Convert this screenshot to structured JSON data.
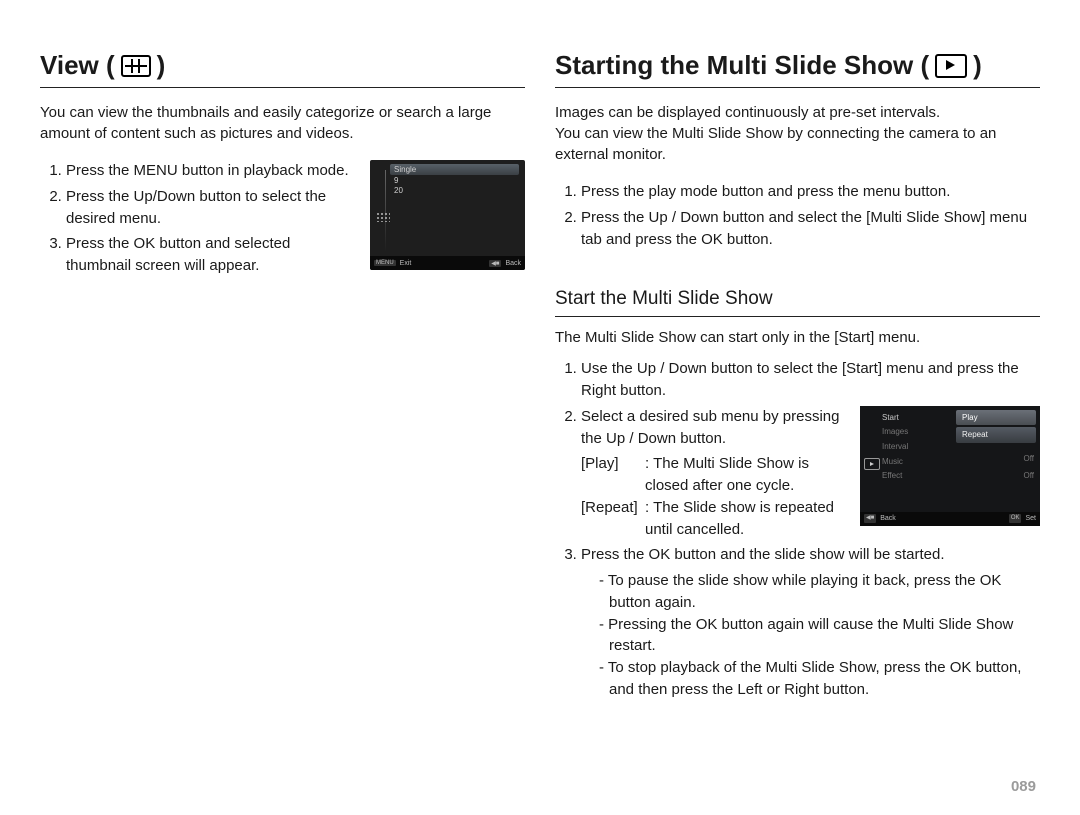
{
  "page_number": "089",
  "left": {
    "title_prefix": "View (",
    "title_suffix": ")",
    "intro": "You can view the thumbnails and easily categorize or search a large amount of content such as pictures and videos.",
    "steps": [
      "Press the MENU button in playback mode.",
      "Press the Up/Down button to select the desired menu.",
      "Press the OK button and selected thumbnail screen will appear."
    ],
    "thumb": {
      "items": [
        "Single",
        "9",
        "20"
      ],
      "bottom_left": "Exit",
      "bottom_left_key": "MENU",
      "bottom_right": "Back",
      "bottom_right_key": "◀■"
    }
  },
  "right": {
    "title_prefix": "Starting the Multi Slide Show (",
    "title_suffix": ")",
    "intro1": "Images can be displayed continuously at pre-set intervals.",
    "intro2": "You can view the Multi Slide Show by connecting the camera to an external monitor.",
    "steps_top": [
      "Press the play mode button and press the menu button.",
      "Press the Up / Down button and select the [Multi Slide Show] menu tab and press the OK button."
    ],
    "subtitle": "Start the Multi Slide Show",
    "sub_intro": "The Multi Slide Show can start only in the [Start] menu.",
    "sub_step1": "Use the Up / Down button to select the [Start] menu and press the Right button.",
    "sub_step2_a": "Select a desired sub menu by pressing the Up / Down button.",
    "play_term": "[Play]",
    "play_def": ": The Multi Slide Show is closed after one cycle.",
    "repeat_term": "[Repeat]",
    "repeat_def": ": The Slide show is repeated until cancelled.",
    "sub_step3": "Press the OK button and the slide show will be started.",
    "bullets": [
      "- To pause the slide show while playing it back, press the OK button again.",
      "- Pressing the OK button again will cause the Multi Slide Show restart.",
      "- To stop playback of the Multi Slide Show, press the OK button, and then press the Left or Right button."
    ],
    "thumb": {
      "left_menu": [
        "Start",
        "Images",
        "Interval",
        "Music",
        "Effect"
      ],
      "left_vals": [
        "",
        "",
        "",
        "",
        ""
      ],
      "right_options": [
        "Play",
        "Repeat"
      ],
      "right_vals": [
        "",
        "",
        "",
        "Off",
        "Off"
      ],
      "bottom_left_key": "◀■",
      "bottom_left": "Back",
      "bottom_right_key": "OK",
      "bottom_right": "Set"
    }
  }
}
